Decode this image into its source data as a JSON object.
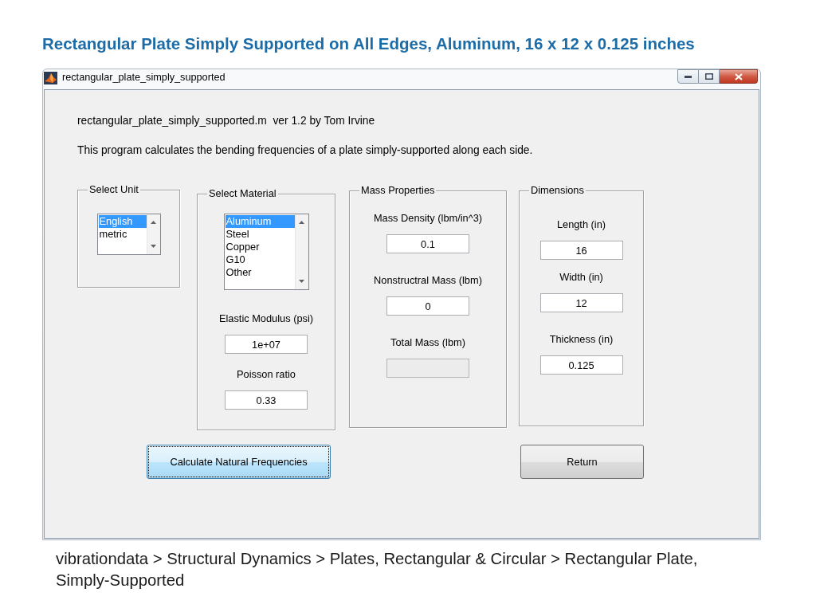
{
  "slide_title": "Rectangular Plate Simply Supported on All Edges, Aluminum, 16 x 12 x 0.125 inches",
  "window": {
    "title": "rectangular_plate_simply_supported"
  },
  "intro_lines": [
    "rectangular_plate_simply_supported.m  ver 1.2 by Tom Irvine",
    "This program calculates the bending frequencies of a plate simply-supported along each side."
  ],
  "panels": [
    {
      "title": "Select Unit",
      "options": [
        {
          "label": "English",
          "selected": true
        },
        {
          "label": "metric",
          "selected": false
        }
      ]
    },
    {
      "title": "Select Material",
      "options": [
        {
          "label": "Aluminum",
          "selected": true
        },
        {
          "label": "Steel",
          "selected": false
        },
        {
          "label": "Copper",
          "selected": false
        },
        {
          "label": "G10",
          "selected": false
        },
        {
          "label": "Other",
          "selected": false
        }
      ],
      "fields": [
        {
          "label": "Elastic Modulus (psi)",
          "value": "1e+07",
          "disabled": false
        },
        {
          "label": "Poisson ratio",
          "value": "0.33",
          "disabled": false
        }
      ]
    },
    {
      "title": "Mass Properties",
      "fields": [
        {
          "label": "Mass Density (lbm/in^3)",
          "value": "0.1",
          "disabled": false
        },
        {
          "label": "Nonstructral Mass (lbm)",
          "value": "0",
          "disabled": false
        },
        {
          "label": "Total Mass (lbm)",
          "disabled": true
        }
      ]
    },
    {
      "title": "Dimensions",
      "fields": [
        {
          "label": "Length (in)",
          "value": "16",
          "disabled": false
        },
        {
          "label": "Width (in)",
          "value": "12",
          "disabled": false
        },
        {
          "label": "Thickness (in)",
          "value": "0.125",
          "disabled": false
        }
      ]
    }
  ],
  "buttons": [
    {
      "label": "Calculate Natural Frequencies",
      "focused": true
    },
    {
      "label": "Return",
      "focused": false
    }
  ],
  "breadcrumb": "vibrationdata > Structural Dynamics > Plates, Rectangular & Circular > Rectangular Plate, Simply-Supported"
}
